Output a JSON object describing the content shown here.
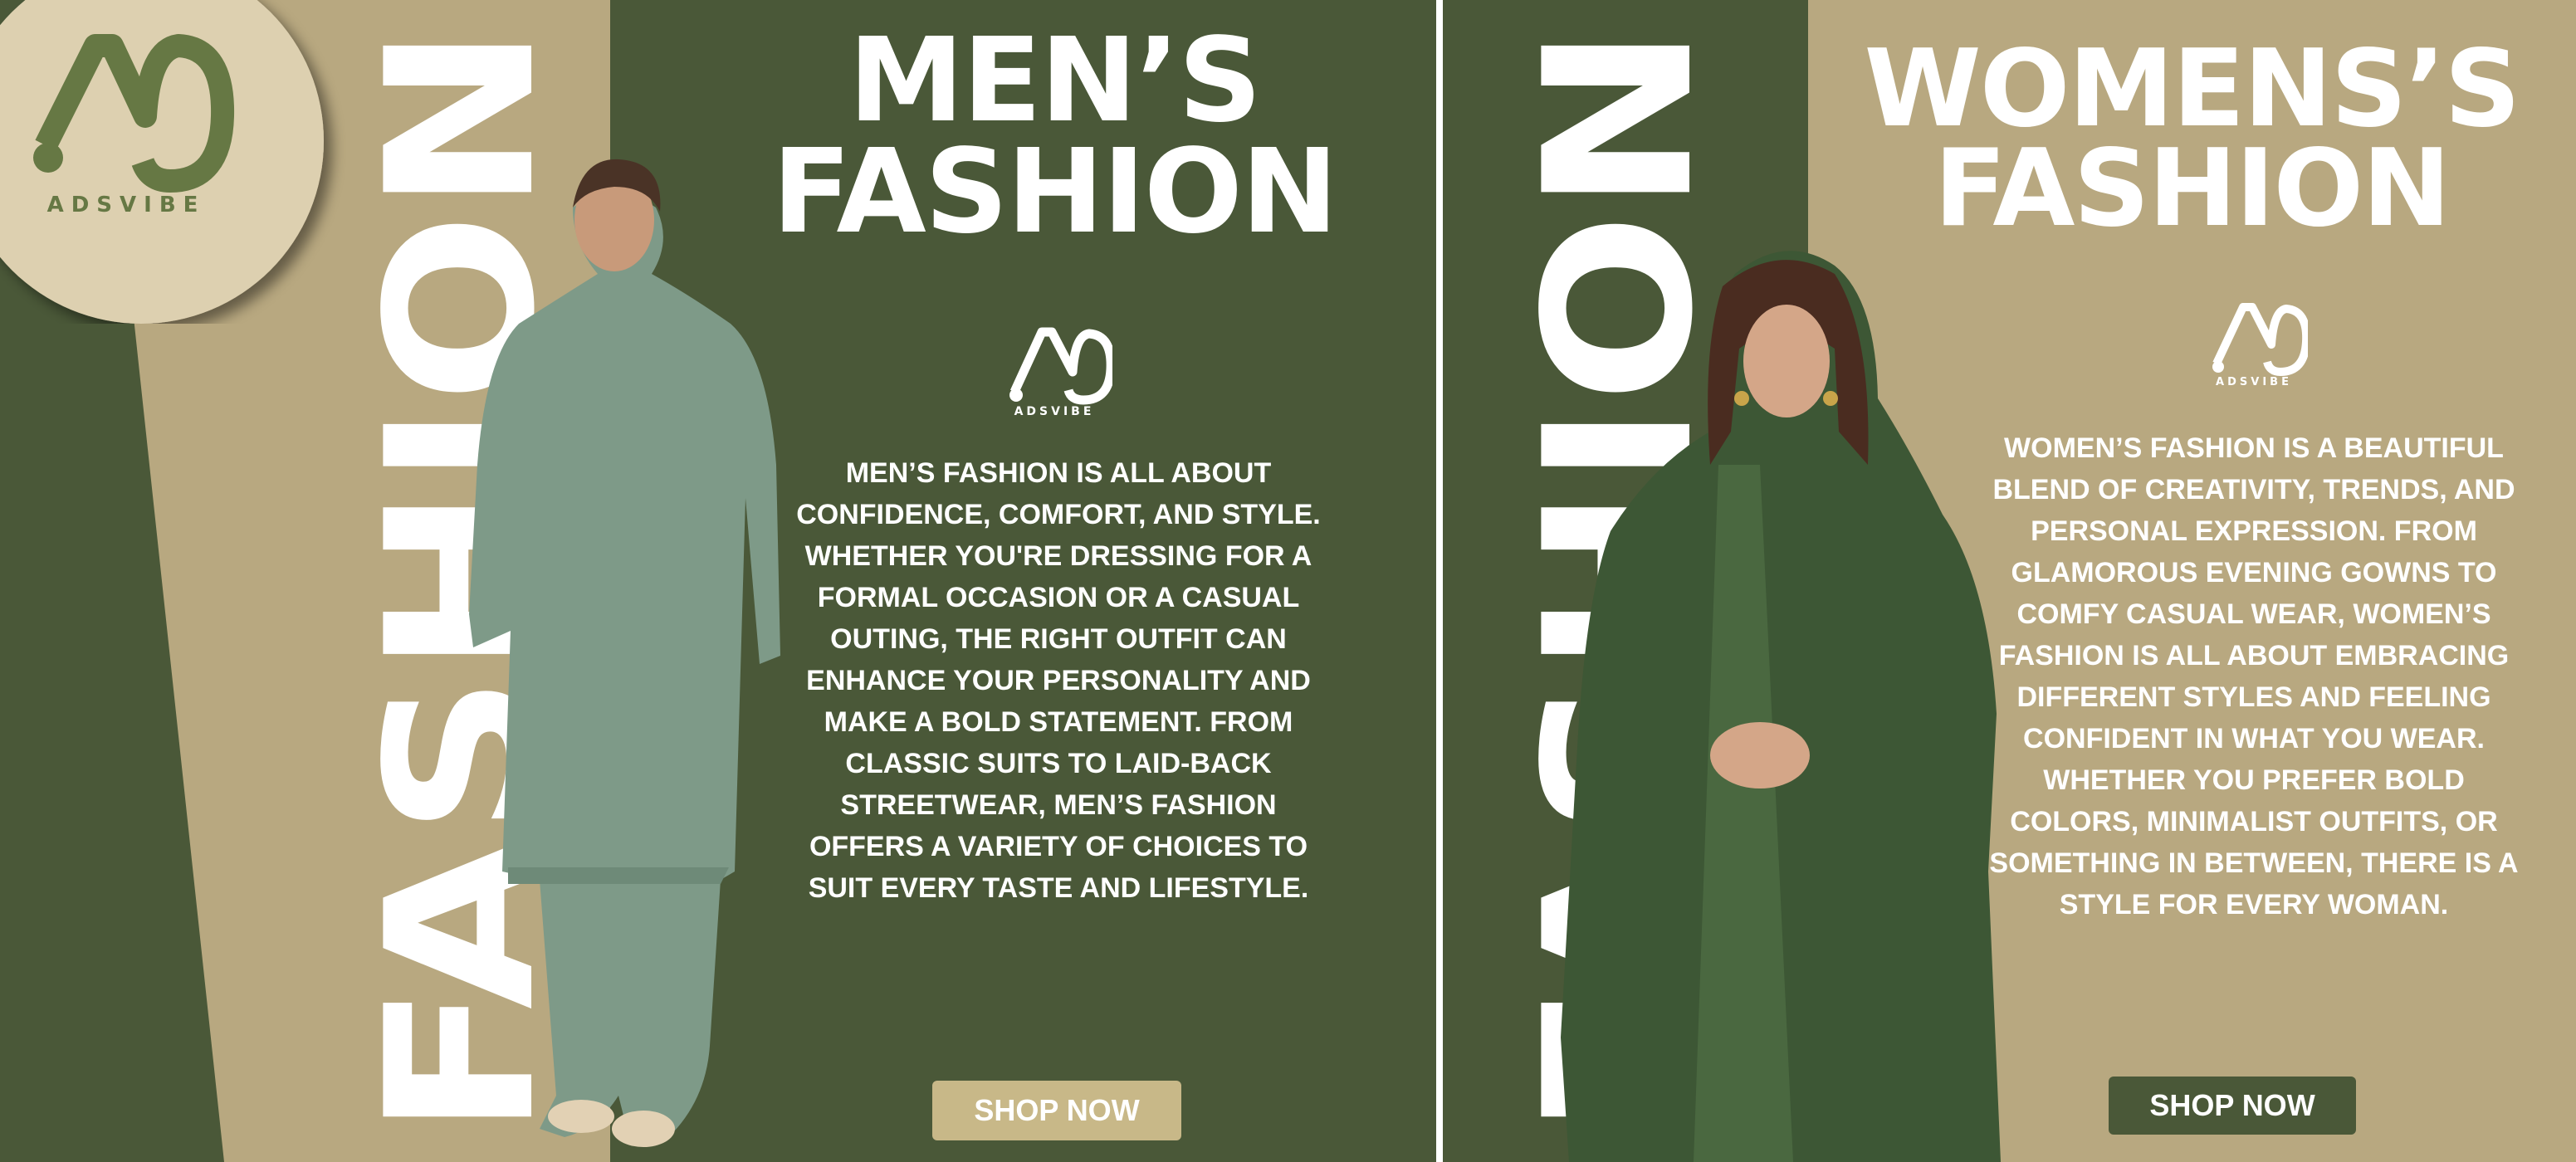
{
  "brand": {
    "name": "ADSVIBE"
  },
  "colors": {
    "olive": "#4a5838",
    "khaki": "#b8a880",
    "cream": "#ddd0b0",
    "white": "#ffffff",
    "logo_green": "#667844"
  },
  "men": {
    "title_line1": "MEN’S",
    "title_line2": "FASHION",
    "vertical_word": "FASHION",
    "body": "MEN’S FASHION IS ALL ABOUT CONFIDENCE, COMFORT, AND STYLE. WHETHER YOU'RE DRESSING FOR A FORMAL OCCASION OR A CASUAL OUTING, THE RIGHT OUTFIT CAN ENHANCE YOUR PERSONALITY AND MAKE A BOLD STATEMENT. FROM CLASSIC SUITS TO LAID-BACK STREETWEAR, MEN’S FASHION OFFERS A VARIETY OF CHOICES TO SUIT EVERY TASTE AND LIFESTYLE.",
    "cta": "SHOP NOW"
  },
  "women": {
    "title_line1": "WOMENS’S",
    "title_line2": "FASHION",
    "vertical_word": "FASHION",
    "body": "WOMEN’S FASHION IS A BEAUTIFUL BLEND OF CREATIVITY, TRENDS, AND PERSONAL EXPRESSION. FROM GLAMOROUS EVENING GOWNS TO COMFY CASUAL WEAR, WOMEN’S FASHION IS ALL ABOUT EMBRACING DIFFERENT STYLES AND FEELING CONFIDENT IN WHAT YOU WEAR. WHETHER YOU PREFER BOLD COLORS, MINIMALIST OUTFITS, OR SOMETHING IN BETWEEN, THERE IS A STYLE FOR EVERY WOMAN.",
    "cta": "SHOP NOW"
  }
}
